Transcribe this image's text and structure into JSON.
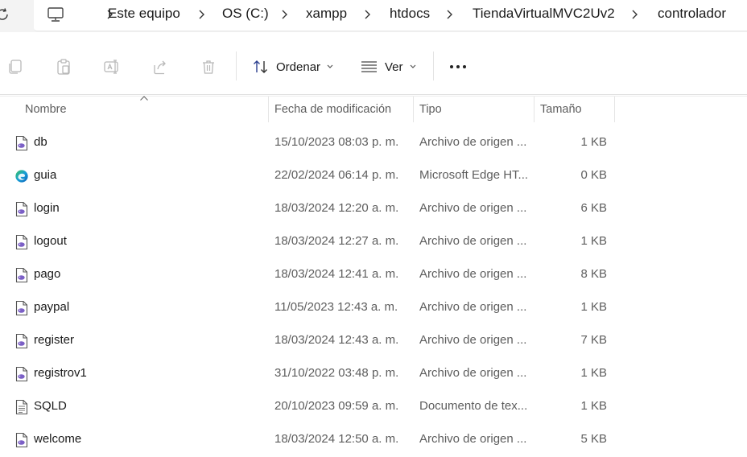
{
  "breadcrumb": {
    "items": [
      "Este equipo",
      "OS (C:)",
      "xampp",
      "htdocs",
      "TiendaVirtualMVC2Uv2",
      "controlador"
    ]
  },
  "toolbar": {
    "sort_label": "Ordenar",
    "view_label": "Ver",
    "icons": [
      "copy-icon",
      "paste-icon",
      "rename-icon",
      "share-icon",
      "delete-icon"
    ]
  },
  "columns": {
    "name": "Nombre",
    "date": "Fecha de modificación",
    "type": "Tipo",
    "size": "Tamaño"
  },
  "files": [
    {
      "name": "db",
      "date": "15/10/2023 08:03 p. m.",
      "type": "Archivo de origen ...",
      "size": "1 KB",
      "icon": "php-file-icon"
    },
    {
      "name": "guia",
      "date": "22/02/2024 06:14 p. m.",
      "type": "Microsoft Edge HT...",
      "size": "0 KB",
      "icon": "edge-html-icon"
    },
    {
      "name": "login",
      "date": "18/03/2024 12:20 a. m.",
      "type": "Archivo de origen ...",
      "size": "6 KB",
      "icon": "php-file-icon"
    },
    {
      "name": "logout",
      "date": "18/03/2024 12:27 a. m.",
      "type": "Archivo de origen ...",
      "size": "1 KB",
      "icon": "php-file-icon"
    },
    {
      "name": "pago",
      "date": "18/03/2024 12:41 a. m.",
      "type": "Archivo de origen ...",
      "size": "8 KB",
      "icon": "php-file-icon"
    },
    {
      "name": "paypal",
      "date": "11/05/2023 12:43 a. m.",
      "type": "Archivo de origen ...",
      "size": "1 KB",
      "icon": "php-file-icon"
    },
    {
      "name": "register",
      "date": "18/03/2024 12:43 a. m.",
      "type": "Archivo de origen ...",
      "size": "7 KB",
      "icon": "php-file-icon"
    },
    {
      "name": "registrov1",
      "date": "31/10/2022 03:48 p. m.",
      "type": "Archivo de origen ...",
      "size": "1 KB",
      "icon": "php-file-icon"
    },
    {
      "name": "SQLD",
      "date": "20/10/2023 09:59 a. m.",
      "type": "Documento de tex...",
      "size": "1 KB",
      "icon": "text-file-icon"
    },
    {
      "name": "welcome",
      "date": "18/03/2024 12:50 a. m.",
      "type": "Archivo de origen ...",
      "size": "5 KB",
      "icon": "php-file-icon"
    }
  ],
  "colors": {
    "accent_purple": "#7b5fc6",
    "edge_blue": "#0c7fd6",
    "edge_green": "#3cc35a"
  }
}
